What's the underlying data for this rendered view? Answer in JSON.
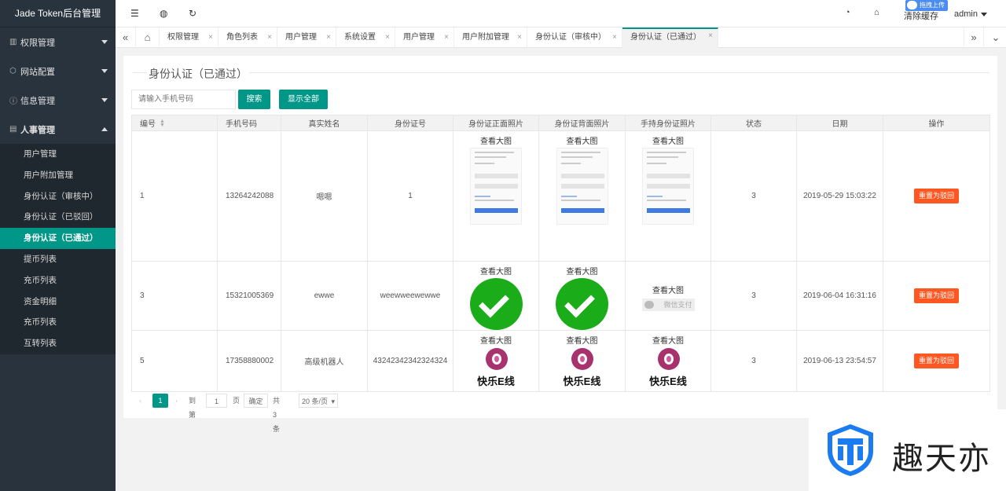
{
  "app": {
    "title": "Jade Token后台管理"
  },
  "sidebar": {
    "groups": [
      {
        "label": "权限管理",
        "icon": "permission-icon"
      },
      {
        "label": "网站配置",
        "icon": "site-config-icon"
      },
      {
        "label": "信息管理",
        "icon": "info-icon"
      },
      {
        "label": "人事管理",
        "icon": "personnel-icon"
      }
    ],
    "items": [
      {
        "label": "用户管理"
      },
      {
        "label": "用户附加管理"
      },
      {
        "label": "身份认证（审核中）"
      },
      {
        "label": "身份认证（已驳回）"
      },
      {
        "label": "身份认证（已通过）"
      },
      {
        "label": "提币列表"
      },
      {
        "label": "充币列表"
      },
      {
        "label": "资金明细"
      },
      {
        "label": "充币列表"
      },
      {
        "label": "互转列表"
      }
    ]
  },
  "topbar": {
    "clear_cache": "清除缓存",
    "user": "admin",
    "upload_badge": "拖拽上传"
  },
  "tabs": [
    {
      "label": "权限管理"
    },
    {
      "label": "角色列表"
    },
    {
      "label": "用户管理"
    },
    {
      "label": "系统设置"
    },
    {
      "label": "用户管理"
    },
    {
      "label": "用户附加管理"
    },
    {
      "label": "身份认证（审核中）"
    },
    {
      "label": "身份认证（已通过）"
    }
  ],
  "panel": {
    "title": "身份认证（已通过）",
    "search_placeholder": "请输入手机号码",
    "search_button": "搜索",
    "show_all_button": "显示全部"
  },
  "table": {
    "headers": [
      "编号",
      "手机号码",
      "真实姓名",
      "身份证号",
      "身份证正面照片",
      "身份证背面照片",
      "手持身份证照片",
      "状态",
      "日期",
      "操作"
    ],
    "view_label": "查看大图",
    "action_label": "重置为驳回",
    "rows": [
      {
        "id": "1",
        "phone": "13264242088",
        "name": "嗯嗯",
        "idno": "1",
        "status": "3",
        "date": "2019-05-29 15:03:22"
      },
      {
        "id": "3",
        "phone": "15321005369",
        "name": "ewwe",
        "idno": "weewweewewwe",
        "status": "3",
        "date": "2019-06-04 16:31:16",
        "wechat_pay": "微信支付"
      },
      {
        "id": "5",
        "phone": "17358880002",
        "name": "高级机器人",
        "idno": "43242342342324324",
        "status": "3",
        "date": "2019-06-13 23:54:57",
        "logo_text": "快乐E线"
      }
    ]
  },
  "pager": {
    "current": "1",
    "goto_prefix": "到第",
    "goto_value": "1",
    "page_unit": "页",
    "confirm": "确定",
    "total": "共 3 条",
    "page_size": "20 条/页"
  },
  "watermark": {
    "text": "趣天亦"
  },
  "colors": {
    "accent": "#009688",
    "danger": "#ff5722",
    "sidebar": "#28333e"
  }
}
